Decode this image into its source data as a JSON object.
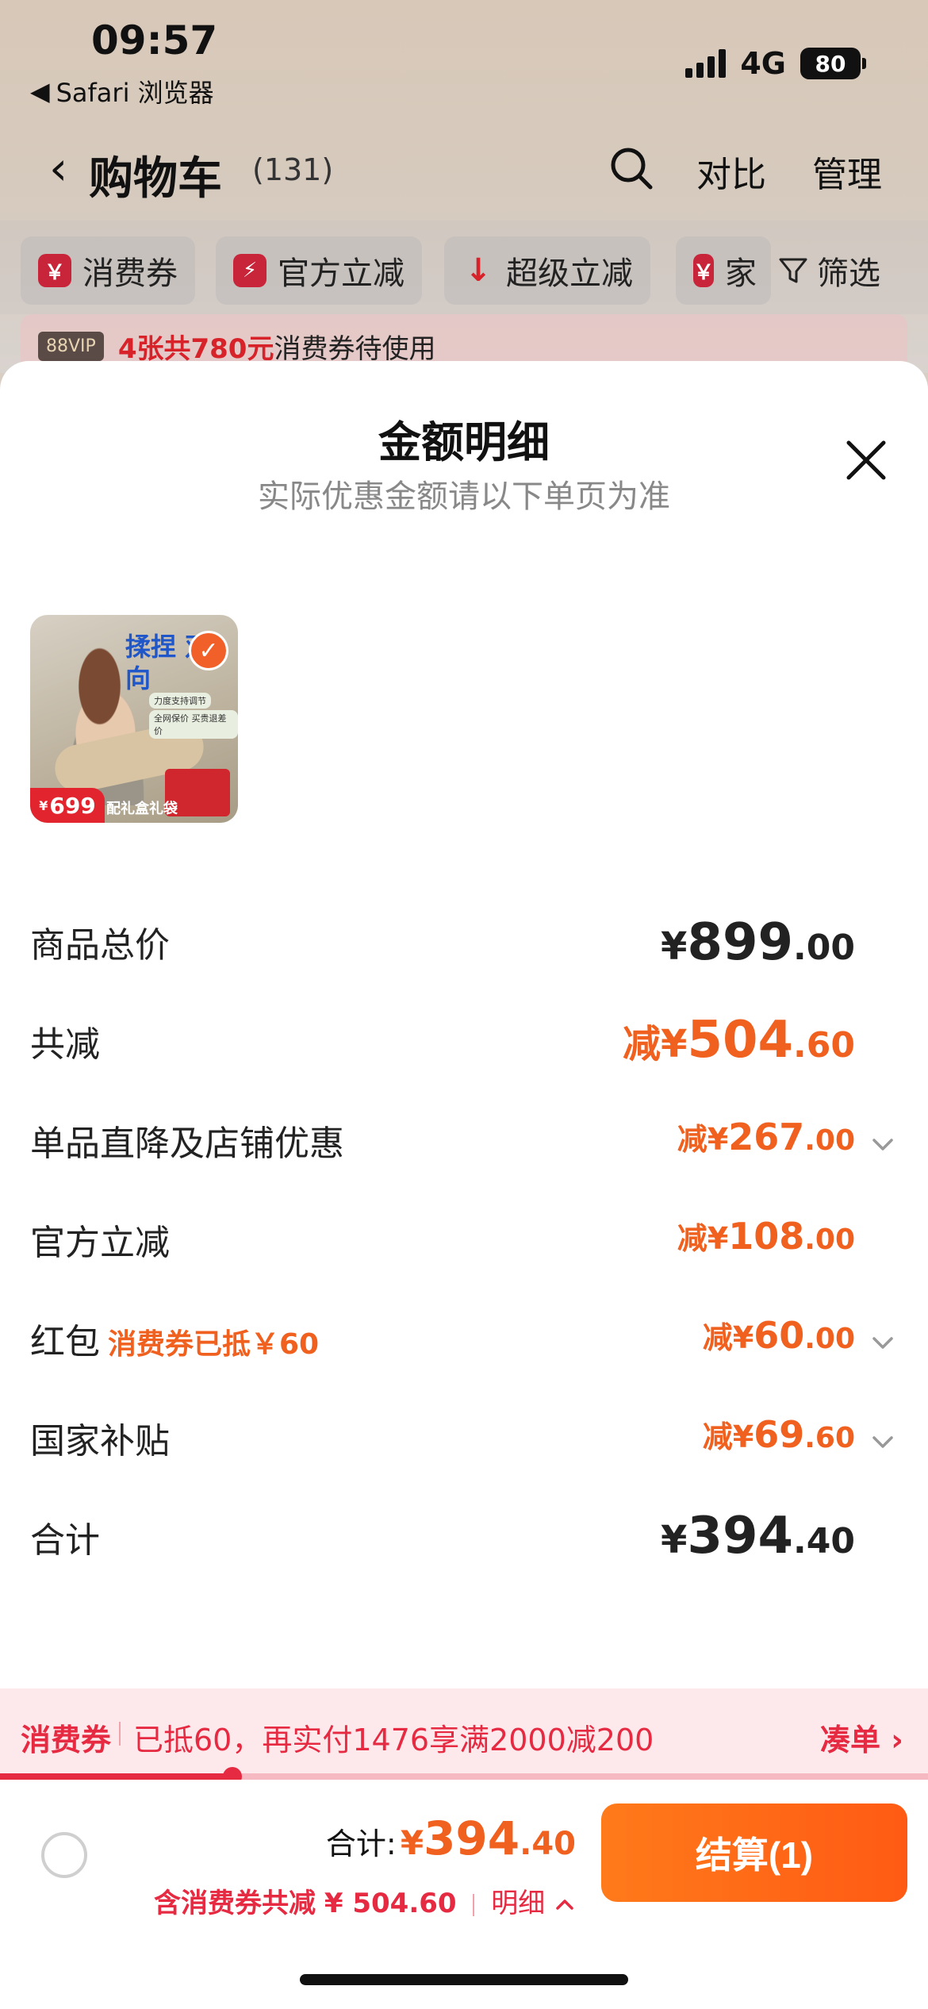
{
  "status_bar": {
    "time": "09:57",
    "back_app": "Safari 浏览器",
    "network": "4G",
    "battery": "80"
  },
  "header": {
    "back_icon": "chevron-left-icon",
    "title": "购物车",
    "count": "(131)",
    "compare": "对比",
    "manage": "管理"
  },
  "filters": {
    "chips": [
      {
        "label": "消费券",
        "icon": "￥"
      },
      {
        "label": "官方立减",
        "icon": "⚡"
      },
      {
        "label": "超级立减",
        "icon": "↓"
      },
      {
        "label": "家",
        "icon": "￥"
      }
    ],
    "filter_label": "筛选"
  },
  "vip_banner": {
    "badge": "88VIP",
    "highlight": "4张共780元",
    "text": "消费券待使用"
  },
  "sheet": {
    "title": "金额明细",
    "subtitle": "实际优惠金额请以下单页为准",
    "product": {
      "headline": "揉捏 双向",
      "tag1": "力度支持调节",
      "tag2": "全网保价 买贵退差价",
      "price_symbol": "¥",
      "price": "699",
      "gift_text": "配礼盒礼袋",
      "selected": true
    },
    "rows": [
      {
        "label": "商品总价",
        "prefix": "¥",
        "int": "899",
        "dec": ".00",
        "style": "black-big"
      },
      {
        "label": "共减",
        "prefix": "减¥",
        "int": "504",
        "dec": ".60",
        "style": "orange-big"
      },
      {
        "label": "单品直降及店铺优惠",
        "prefix": "减¥",
        "int": "267",
        "dec": ".00",
        "style": "orange-mid",
        "expandable": true
      },
      {
        "label": "官方立减",
        "prefix": "减¥",
        "int": "108",
        "dec": ".00",
        "style": "orange-mid"
      },
      {
        "label": "红包",
        "note": "消费券已抵￥60",
        "prefix": "减¥",
        "int": "60",
        "dec": ".00",
        "style": "orange-mid",
        "expandable": true
      },
      {
        "label": "国家补贴",
        "prefix": "减¥",
        "int": "69",
        "dec": ".60",
        "style": "orange-mid",
        "expandable": true
      },
      {
        "label": "合计",
        "prefix": "¥",
        "int": "394",
        "dec": ".40",
        "style": "black-big"
      }
    ]
  },
  "coupon_bar": {
    "label": "消费券",
    "text": "已抵60，再实付1476享满2000减200",
    "link": "凑单",
    "progress": 0.25
  },
  "checkout": {
    "total_label": "合计:",
    "total_yen": "¥",
    "total_int": "394",
    "total_dec": ".40",
    "discount_text": "含消费券共减",
    "discount_amount": "¥ 504.60",
    "detail_label": "明细",
    "button_label": "结算(1)"
  },
  "colors": {
    "accent_orange": "#f0601f",
    "accent_red": "#e52a42"
  }
}
